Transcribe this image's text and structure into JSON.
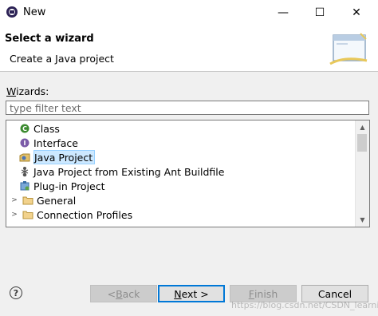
{
  "window": {
    "title": "New",
    "minimize": "—",
    "maximize": "☐",
    "close": "✕"
  },
  "header": {
    "title": "Select a wizard",
    "subtitle": "Create a Java project",
    "graphic_icon": "wizard-banner-icon"
  },
  "wizards_label_mnemonic": "W",
  "wizards_label_rest": "izards:",
  "filter": {
    "placeholder": "type filter text",
    "value": ""
  },
  "tree": {
    "items": [
      {
        "label": "Class",
        "icon": "class-icon",
        "selected": false
      },
      {
        "label": "Interface",
        "icon": "interface-icon",
        "selected": false
      },
      {
        "label": "Java Project",
        "icon": "java-project-icon",
        "selected": true
      },
      {
        "label": "Java Project from Existing Ant Buildfile",
        "icon": "ant-icon",
        "selected": false
      },
      {
        "label": "Plug-in Project",
        "icon": "plugin-project-icon",
        "selected": false
      },
      {
        "label": "General",
        "icon": "folder-icon",
        "expandable": true
      },
      {
        "label": "Connection Profiles",
        "icon": "folder-icon",
        "expandable": true
      }
    ]
  },
  "buttons": {
    "help": "?",
    "back_prefix": "< ",
    "back_mnemonic": "B",
    "back_rest": "ack",
    "next_mnemonic": "N",
    "next_rest": "ext >",
    "finish_mnemonic": "F",
    "finish_rest": "inish",
    "cancel": "Cancel"
  },
  "watermark": "https://blog.csdn.net/CSDN_learning"
}
